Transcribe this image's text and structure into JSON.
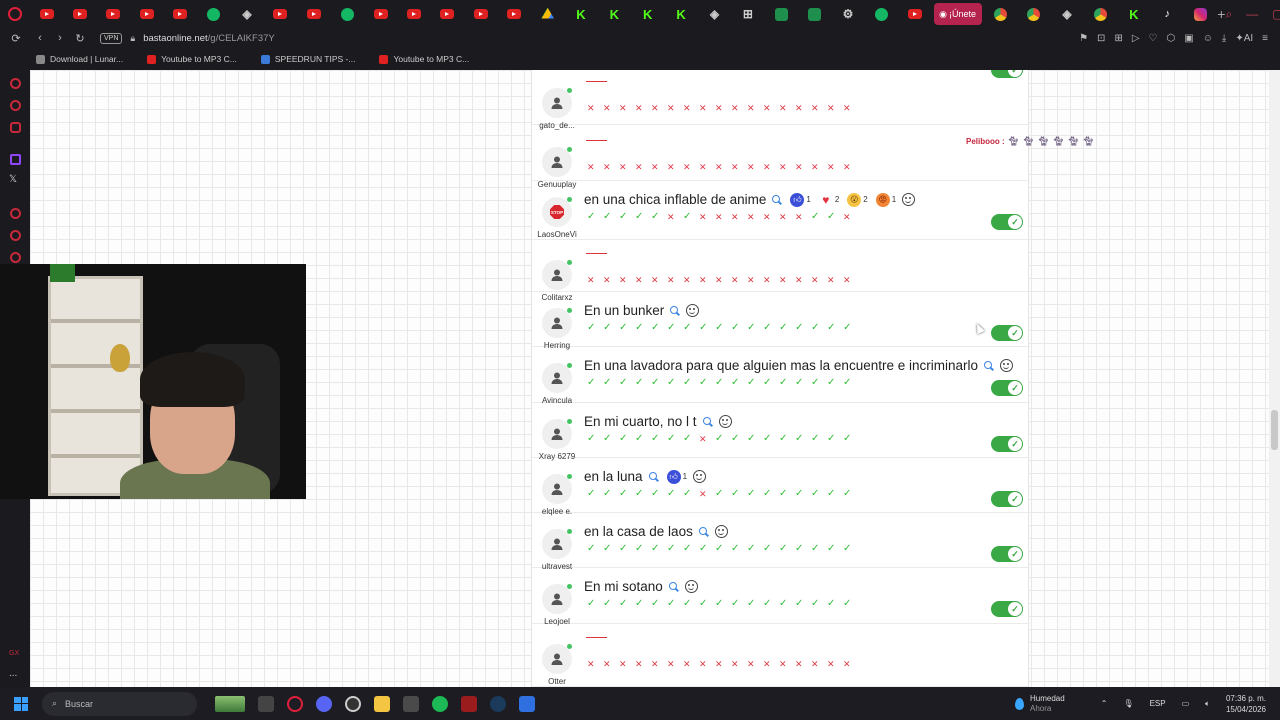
{
  "browser": {
    "active_tab_label": "¡Únete",
    "url_host": "bastaonline.net",
    "url_path": "/g/CELAIKF37Y",
    "vpn_label": "VPN",
    "tabs": [
      "youtube",
      "youtube",
      "youtube",
      "youtube",
      "youtube",
      "green",
      "dark",
      "youtube",
      "youtube",
      "green",
      "youtube",
      "youtube",
      "youtube",
      "youtube",
      "youtube",
      "drive",
      "kick",
      "kick",
      "kick",
      "kick",
      "dark",
      "grid",
      "sheet",
      "sheet",
      "settings",
      "green",
      "youtube",
      "active",
      "chrome",
      "chrome",
      "dark",
      "chrome",
      "kick",
      "tiktok",
      "instagram"
    ]
  },
  "bookmarks": [
    {
      "label": "Download | Lunar...",
      "color": "#888888"
    },
    {
      "label": "Youtube to MP3 C...",
      "color": "#e02121"
    },
    {
      "label": "SPEEDRUN TIPS -...",
      "color": "#3a7ad8"
    },
    {
      "label": "Youtube to MP3 C...",
      "color": "#e02121"
    }
  ],
  "sidebar_labels": [
    "GX",
    "..."
  ],
  "chat_note": {
    "user": "Pelibooo :"
  },
  "rows": [
    {
      "user": "gato_de...",
      "answer": "",
      "marks": "xxxxxxxxxxxxxxxxx",
      "toggle": false,
      "reactions": []
    },
    {
      "user": "Genuuplay",
      "answer": "",
      "marks": "xxxxxxxxxxxxxxxxx",
      "toggle": false,
      "reactions": []
    },
    {
      "user": "LaosOneVi",
      "answer": "en una chica inflable de anime",
      "marks": "vvvvvxvxxxxxxxvvx",
      "toggle": true,
      "reactions": [
        {
          "type": "like",
          "count": "1"
        },
        {
          "type": "heart",
          "count": "2"
        },
        {
          "type": "wow",
          "count": "2"
        },
        {
          "type": "angry",
          "count": "1"
        }
      ],
      "avatar": "stop"
    },
    {
      "user": "Colitarxz",
      "answer": "",
      "marks": "xxxxxxxxxxxxxxxxx",
      "toggle": false,
      "reactions": []
    },
    {
      "user": "Herring",
      "answer": "En un bunker",
      "marks": "vvvvvvvvvvvvvvvvv",
      "toggle": true,
      "reactions": []
    },
    {
      "user": "Avincula",
      "answer": "En una lavadora para que alguien mas la encuentre e incriminarlo",
      "marks": "vvvvvvvvvvvvvvvvv",
      "toggle": true,
      "reactions": []
    },
    {
      "user": "Xray 6279",
      "answer": "En mi cuarto, no l t",
      "marks": "vvvvvvvxvvvvvvvvv",
      "toggle": true,
      "reactions": []
    },
    {
      "user": "elqlee e.",
      "answer": "en la luna",
      "marks": "vvvvvvvxvvvvvvvvv",
      "toggle": true,
      "reactions": [
        {
          "type": "like",
          "count": "1"
        }
      ]
    },
    {
      "user": "ultravest",
      "answer": "en la casa de laos",
      "marks": "vvvvvvvvvvvvvvvvv",
      "toggle": true,
      "reactions": []
    },
    {
      "user": "Leojoel",
      "answer": "En mi sotano",
      "marks": "vvvvvvvvvvvvvvvvv",
      "toggle": true,
      "reactions": []
    },
    {
      "user": "Otter",
      "answer": "",
      "marks": "xxxxxxxxxxxxxxxxx",
      "toggle": false,
      "reactions": []
    }
  ],
  "taskbar": {
    "search_placeholder": "Buscar",
    "weather_title": "Humedad",
    "weather_sub": "Ahora",
    "lang": "ESP",
    "time": "07:36 p. m.",
    "date": "15/04/2026"
  },
  "colors": {
    "ok": "#2fbd3a",
    "ko": "#e23b48",
    "toggle": "#39a845",
    "accent": "#b5244f"
  }
}
